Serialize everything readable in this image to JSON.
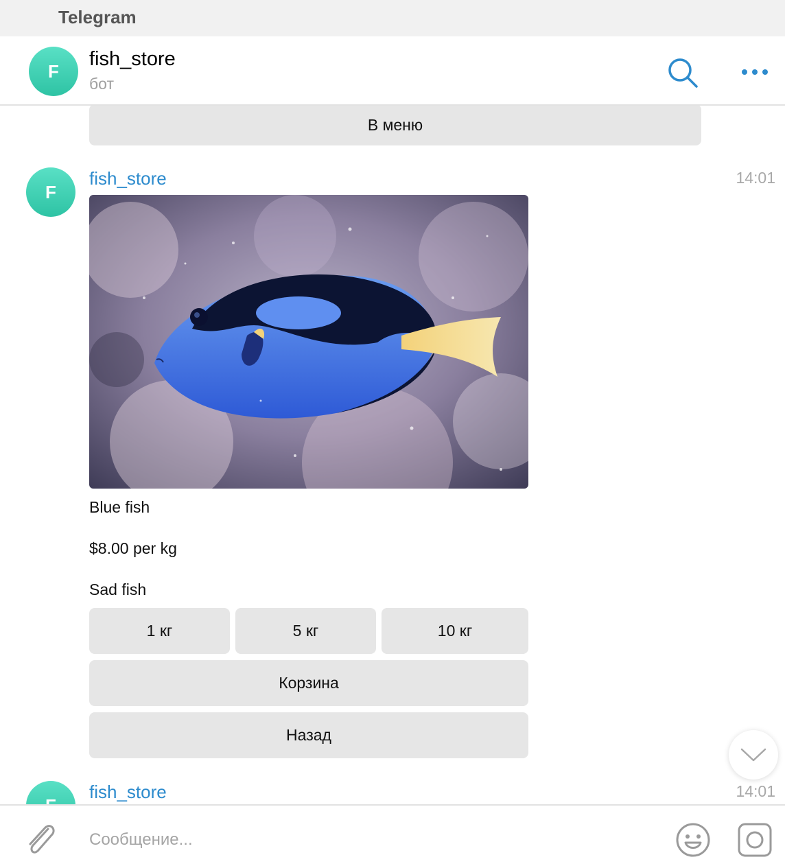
{
  "window": {
    "title": "Telegram"
  },
  "header": {
    "avatar_letter": "F",
    "chat_name": "fish_store",
    "status": "бот",
    "search_icon": "search-icon",
    "more_icon": "more-dots-icon"
  },
  "messages": {
    "prev_keyboard": {
      "menu_button": "В меню"
    },
    "product": {
      "avatar_letter": "F",
      "sender": "fish_store",
      "time": "14:01",
      "photo_subject": "blue-tang-fish-photo",
      "title": "Blue fish",
      "price": "$8.00 per kg",
      "description": "Sad fish",
      "keyboard": {
        "qty_1": "1 кг",
        "qty_5": "5 кг",
        "qty_10": "10 кг",
        "cart": "Корзина",
        "back": "Назад"
      }
    },
    "next": {
      "avatar_letter": "F",
      "sender": "fish_store",
      "time": "14:01"
    }
  },
  "composer": {
    "placeholder": "Сообщение...",
    "attach_icon": "paperclip-icon",
    "emoji_icon": "emoji-icon",
    "camera_icon": "camera-icon"
  },
  "colors": {
    "accent": "#2d8bcd",
    "avatar": "#3ecfb2",
    "keyboard_button": "#e6e6e6"
  }
}
